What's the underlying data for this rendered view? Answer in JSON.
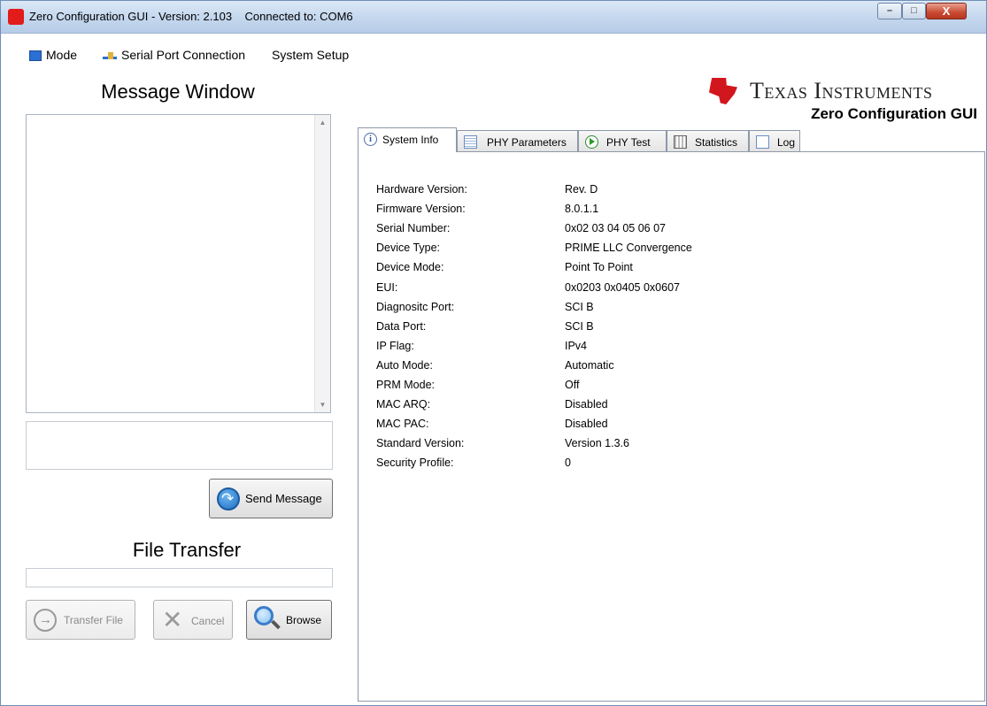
{
  "window": {
    "title": "Zero Configuration GUI - Version: 2.103    Connected to: COM6",
    "min_glyph": "–",
    "max_glyph": "□",
    "close_glyph": "X"
  },
  "menu": {
    "mode": "Mode",
    "serial": "Serial Port Connection",
    "system_setup": "System Setup"
  },
  "message": {
    "title": "Message Window",
    "send_label": "Send Message"
  },
  "file_transfer": {
    "title": "File Transfer",
    "transfer_label": "Transfer File",
    "cancel_label": "Cancel",
    "browse_label": "Browse"
  },
  "brand": {
    "logo_text": "Texas Instruments",
    "subtitle": "Zero Configuration GUI"
  },
  "tabs": [
    {
      "label": "System Info",
      "icon": "info-icon",
      "active": true
    },
    {
      "label": "PHY Parameters",
      "icon": "document-icon",
      "active": false
    },
    {
      "label": "PHY Test",
      "icon": "play-icon",
      "active": false
    },
    {
      "label": "Statistics",
      "icon": "calculator-icon",
      "active": false
    },
    {
      "label": "Log",
      "icon": "log-icon",
      "active": false
    }
  ],
  "system_info": [
    {
      "key": "Hardware Version:",
      "value": "Rev. D"
    },
    {
      "key": "Firmware Version:",
      "value": "8.0.1.1"
    },
    {
      "key": "Serial Number:",
      "value": "0x02 03 04 05 06 07"
    },
    {
      "key": "Device Type:",
      "value": "PRIME LLC Convergence"
    },
    {
      "key": "Device Mode:",
      "value": "Point To Point"
    },
    {
      "key": "EUI:",
      "value": "0x0203 0x0405 0x0607"
    },
    {
      "key": "Diagnositc Port:",
      "value": "SCI B"
    },
    {
      "key": "Data Port:",
      "value": "SCI B"
    },
    {
      "key": "IP Flag:",
      "value": "IPv4"
    },
    {
      "key": "Auto Mode:",
      "value": "Automatic"
    },
    {
      "key": "PRM Mode:",
      "value": "Off"
    },
    {
      "key": "MAC ARQ:",
      "value": "Disabled"
    },
    {
      "key": "MAC PAC:",
      "value": "Disabled"
    },
    {
      "key": "Standard Version:",
      "value": "Version 1.3.6"
    },
    {
      "key": "Security Profile:",
      "value": "0"
    }
  ],
  "colors": {
    "ti_red": "#d2161e",
    "accent_blue": "#1e6fc4"
  }
}
